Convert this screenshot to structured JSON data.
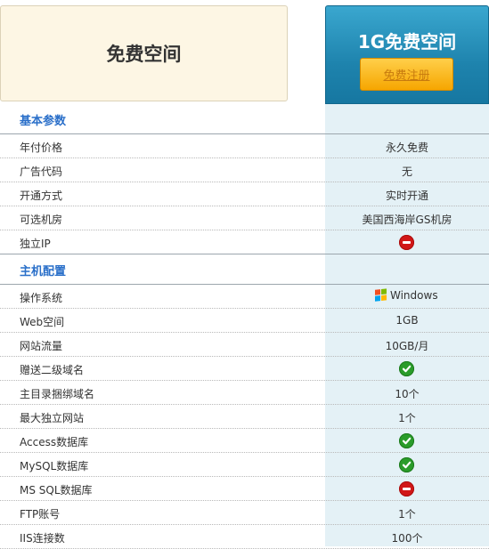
{
  "header": {
    "left_title": "免费空间",
    "plan_title": "1G免费空间",
    "register_label": "免费注册"
  },
  "sections": [
    {
      "title": "基本参数",
      "rows": [
        {
          "label": "年付价格",
          "value": "永久免费",
          "icon": null
        },
        {
          "label": "广告代码",
          "value": "无",
          "icon": null
        },
        {
          "label": "开通方式",
          "value": "实时开通",
          "icon": null
        },
        {
          "label": "可选机房",
          "value": "美国西海岸GS机房",
          "icon": null
        },
        {
          "label": "独立IP",
          "value": null,
          "icon": "no-icon"
        }
      ]
    },
    {
      "title": "主机配置",
      "rows": [
        {
          "label": "操作系统",
          "value": "Windows",
          "icon": "windows-icon"
        },
        {
          "label": "Web空间",
          "value": "1GB",
          "icon": null
        },
        {
          "label": "网站流量",
          "value": "10GB/月",
          "icon": null
        },
        {
          "label": "赠送二级域名",
          "value": null,
          "icon": "yes-icon"
        },
        {
          "label": "主目录捆绑域名",
          "value": "10个",
          "icon": null
        },
        {
          "label": "最大独立网站",
          "value": "1个",
          "icon": null
        },
        {
          "label": "Access数据库",
          "value": null,
          "icon": "yes-icon"
        },
        {
          "label": "MySQL数据库",
          "value": null,
          "icon": "yes-icon"
        },
        {
          "label": "MS SQL数据库",
          "value": null,
          "icon": "no-icon"
        },
        {
          "label": "FTP账号",
          "value": "1个",
          "icon": null
        },
        {
          "label": "IIS连接数",
          "value": "100个",
          "icon": null
        }
      ]
    }
  ],
  "colors": {
    "accent_blue": "#1e83ad",
    "section_title": "#2a6fc9",
    "button_orange": "#f6a600",
    "yes_green": "#2a9c2a",
    "no_red": "#d11717",
    "left_header_bg": "#fdf6e4",
    "value_column_bg": "#e4f1f6"
  }
}
